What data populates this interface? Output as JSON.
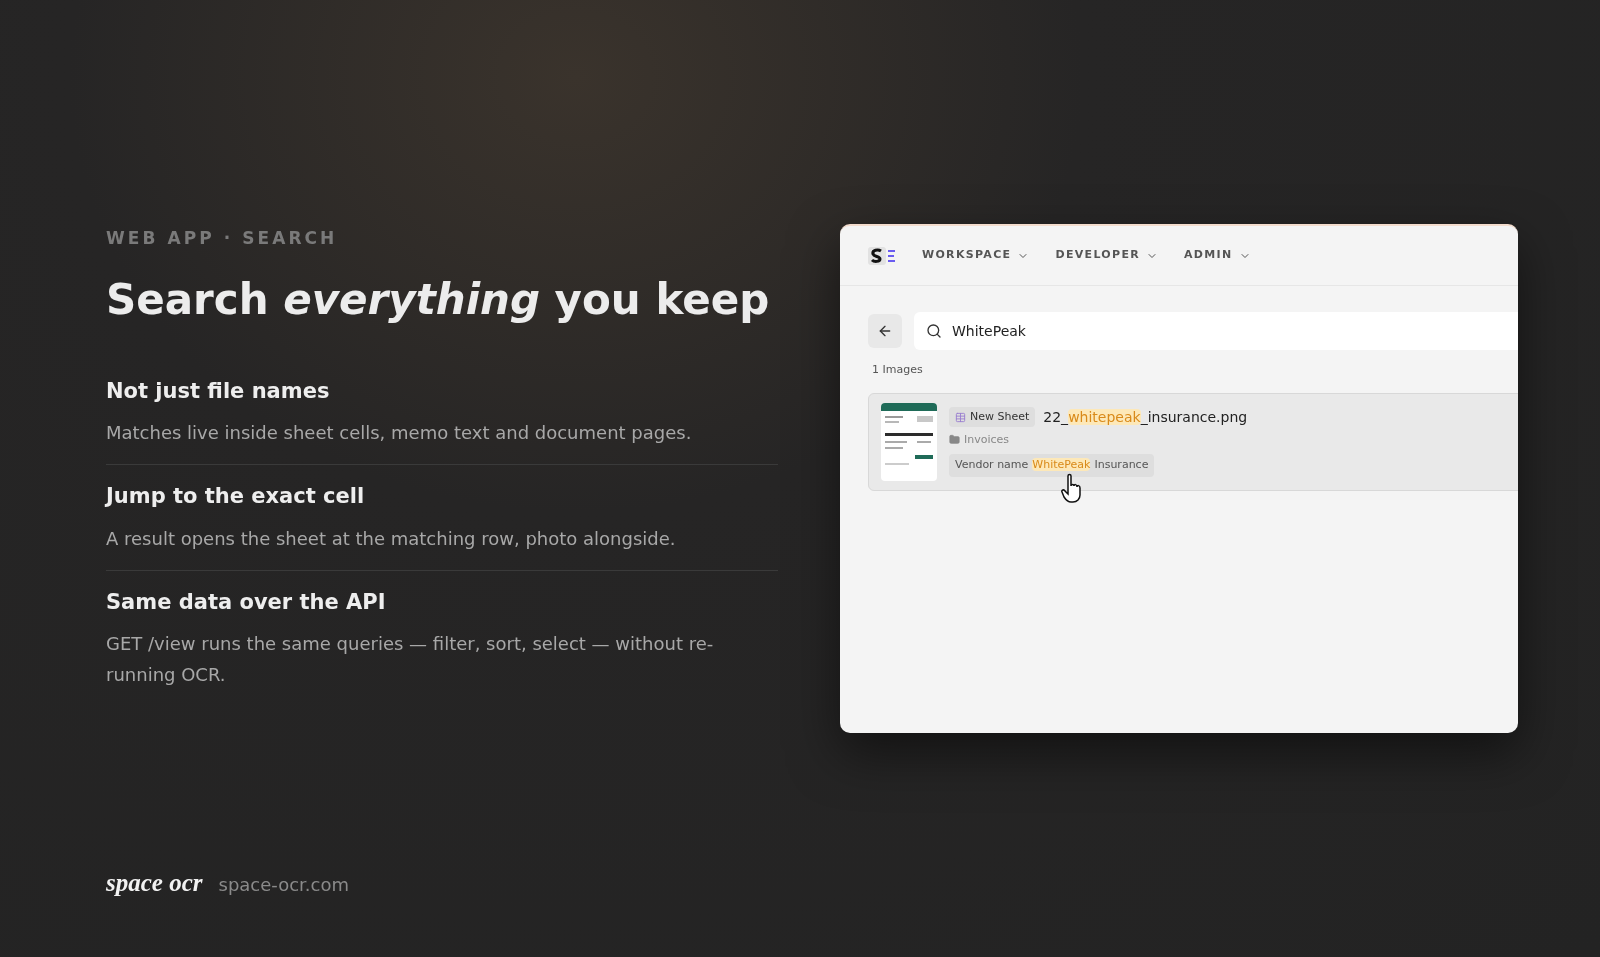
{
  "eyebrow": "WEB APP · SEARCH",
  "headline": "Search *everything* you keep",
  "features": [
    {
      "title": "Not just file names",
      "body": "Matches live inside sheet cells, memo text and document pages."
    },
    {
      "title": "Jump to the exact cell",
      "body": "A result opens the sheet at the matching row, photo alongside."
    },
    {
      "title": "Same data over the API",
      "body": "GET /view runs the same queries — filter, sort, select — without re-running OCR."
    }
  ],
  "footer": {
    "brand": "space ocr",
    "url": "space-ocr.com"
  },
  "app": {
    "nav": [
      {
        "label": "WORKSPACE"
      },
      {
        "label": "DEVELOPER"
      },
      {
        "label": "ADMIN"
      }
    ],
    "search": {
      "value": "WhitePeak"
    },
    "count": "1 Images",
    "results": [
      {
        "tag": "New Sheet",
        "folder": "Invoices",
        "name_parts": [
          {
            "text": "22_",
            "highlight": false
          },
          {
            "text": "whitepeak",
            "highlight": true
          },
          {
            "text": "_insurance.png",
            "highlight": false
          }
        ],
        "match_label": "Vendor name",
        "match_parts": [
          {
            "text": "WhitePeak",
            "highlight": true
          },
          {
            "text": "Insurance",
            "highlight": false
          }
        ]
      }
    ]
  }
}
